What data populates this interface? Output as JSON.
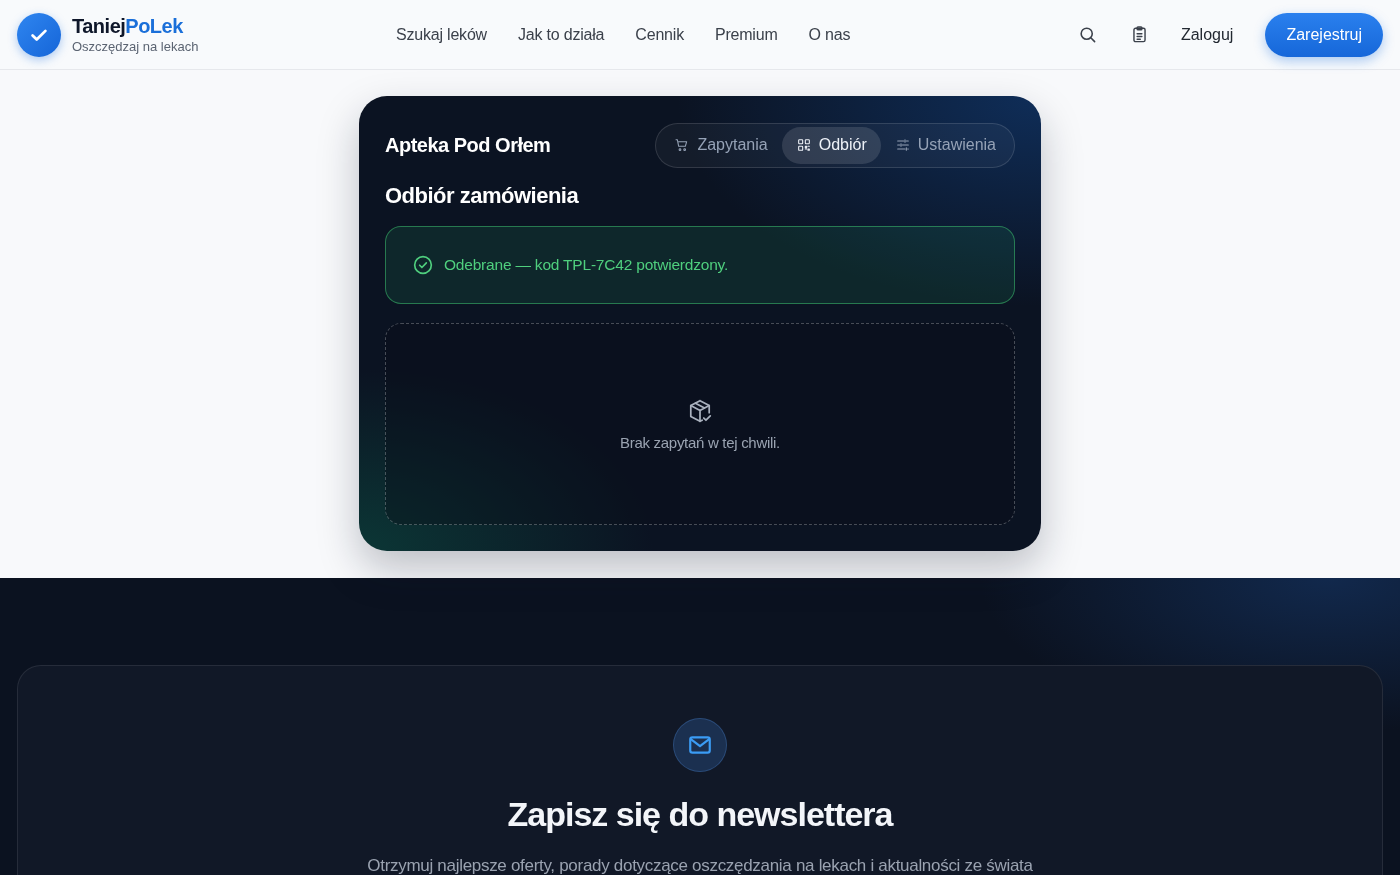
{
  "header": {
    "brand": [
      "Taniej",
      "PoLek"
    ],
    "tagline": "Oszczędzaj na lekach",
    "nav": [
      {
        "label": "Szukaj leków"
      },
      {
        "label": "Jak to działa"
      },
      {
        "label": "Cennik"
      },
      {
        "label": "Premium"
      },
      {
        "label": "O nas"
      }
    ],
    "login": "Zaloguj",
    "register": "Zarejestruj"
  },
  "panel": {
    "pharmacy": "Apteka Pod Orłem",
    "tabs": [
      {
        "label": "Zapytania",
        "selected": false
      },
      {
        "label": "Odbiór",
        "selected": true
      },
      {
        "label": "Ustawienia",
        "selected": false
      }
    ],
    "title": "Odbiór zamówienia",
    "alert": {
      "kind": "success",
      "text": "Odebrane — kod TPL-7C42 potwierdzony."
    },
    "empty_state": {
      "text": "Brak zapytań w tej chwili."
    }
  },
  "newsletter": {
    "title": "Zapisz się do newslettera",
    "description": "Otrzymuj najlepsze oferty, porady dotyczące oszczędzania na lekach i aktualności ze świata"
  }
}
